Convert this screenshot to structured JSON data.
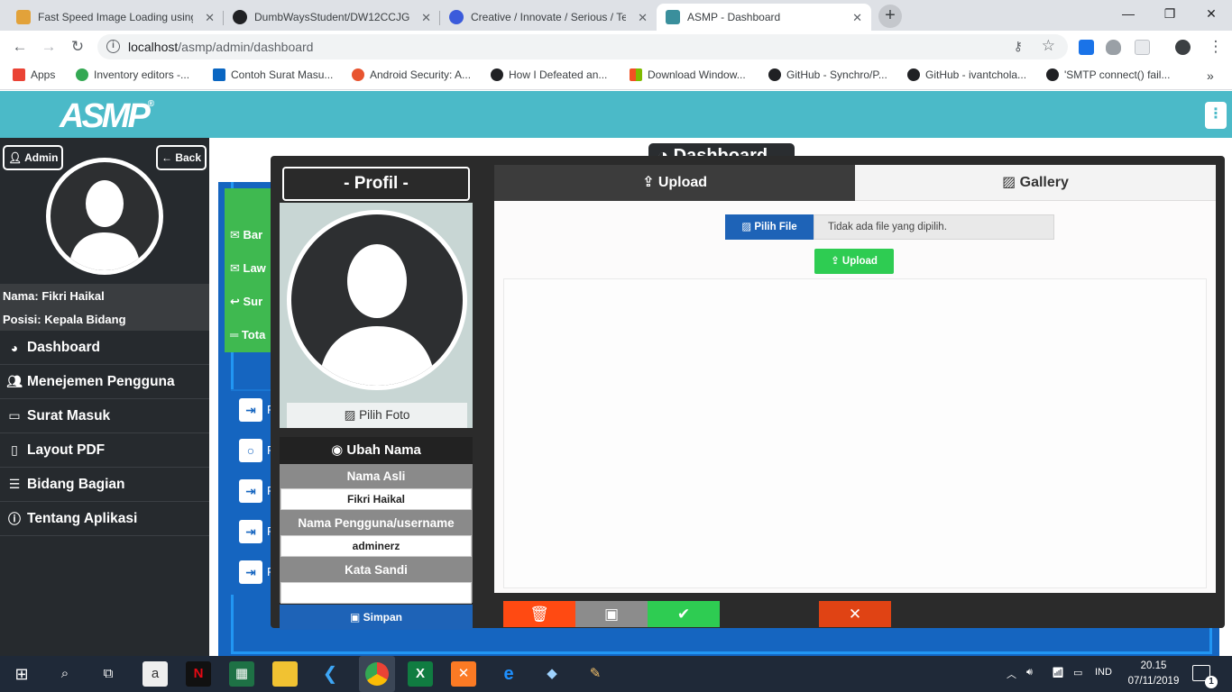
{
  "browser": {
    "tabs": [
      {
        "title": "Fast Speed Image Loading using",
        "color": "#e2a23a"
      },
      {
        "title": "DumbWaysStudent/DW12CCJG9",
        "color": "#202124"
      },
      {
        "title": "Creative / Innovate / Serious / Te",
        "color": "#3b5bdb"
      },
      {
        "title": "ASMP - Dashboard",
        "color": "#3a8f9c"
      }
    ],
    "url_host": "localhost",
    "url_path": "/asmp/admin/dashboard",
    "bookmarks": [
      "Apps",
      "Inventory editors -...",
      "Contoh Surat Masu...",
      "Android Security: A...",
      "How I Defeated an...",
      "Download Window...",
      "GitHub - Synchro/P...",
      "GitHub - ivantchola...",
      "'SMTP connect() fail..."
    ]
  },
  "app": {
    "logo": "ASMP",
    "logo_mark": "®",
    "accent": "#4bbac8"
  },
  "sidebar": {
    "admin_label": "Admin",
    "back_label": "Back",
    "name_line": "Nama: Fikri Haikal",
    "position_line": "Posisi: Kepala Bidang",
    "menu": [
      {
        "label": "Dashboard",
        "icon": "palette-icon"
      },
      {
        "label": "Menejemen Pengguna",
        "icon": "users-icon"
      },
      {
        "label": "Surat Masuk",
        "icon": "inbox-icon"
      },
      {
        "label": "Layout PDF",
        "icon": "file-pdf-icon"
      },
      {
        "label": "Bidang Bagian",
        "icon": "list-icon"
      },
      {
        "label": "Tentang Aplikasi",
        "icon": "info-icon"
      }
    ]
  },
  "dashboard": {
    "title": "Dashboard",
    "green_items": [
      "Bar",
      "Law",
      "Sur",
      "Tota"
    ],
    "list_letters": [
      "F",
      "F",
      "F",
      "F",
      "F"
    ]
  },
  "modal": {
    "profile_title": "- Profil -",
    "choose_photo": "Pilih Foto",
    "change_name": "Ubah Nama",
    "real_name_label": "Nama Asli",
    "real_name_value": "Fikri Haikal",
    "username_label": "Nama Pengguna/username",
    "username_value": "adminerz",
    "password_label": "Kata Sandi",
    "password_value": "",
    "save_label": "Simpan",
    "tab_upload": "Upload",
    "tab_gallery": "Gallery",
    "choose_file": "Pilih File",
    "no_file": "Tidak ada file yang dipilih.",
    "upload_button": "Upload",
    "action_colors": [
      "#ff4a12",
      "#8c8c8c",
      "#2ecc52",
      "#e04314"
    ]
  },
  "taskbar": {
    "language": "IND",
    "time": "20.15",
    "date": "07/11/2019",
    "notifications": "1"
  }
}
